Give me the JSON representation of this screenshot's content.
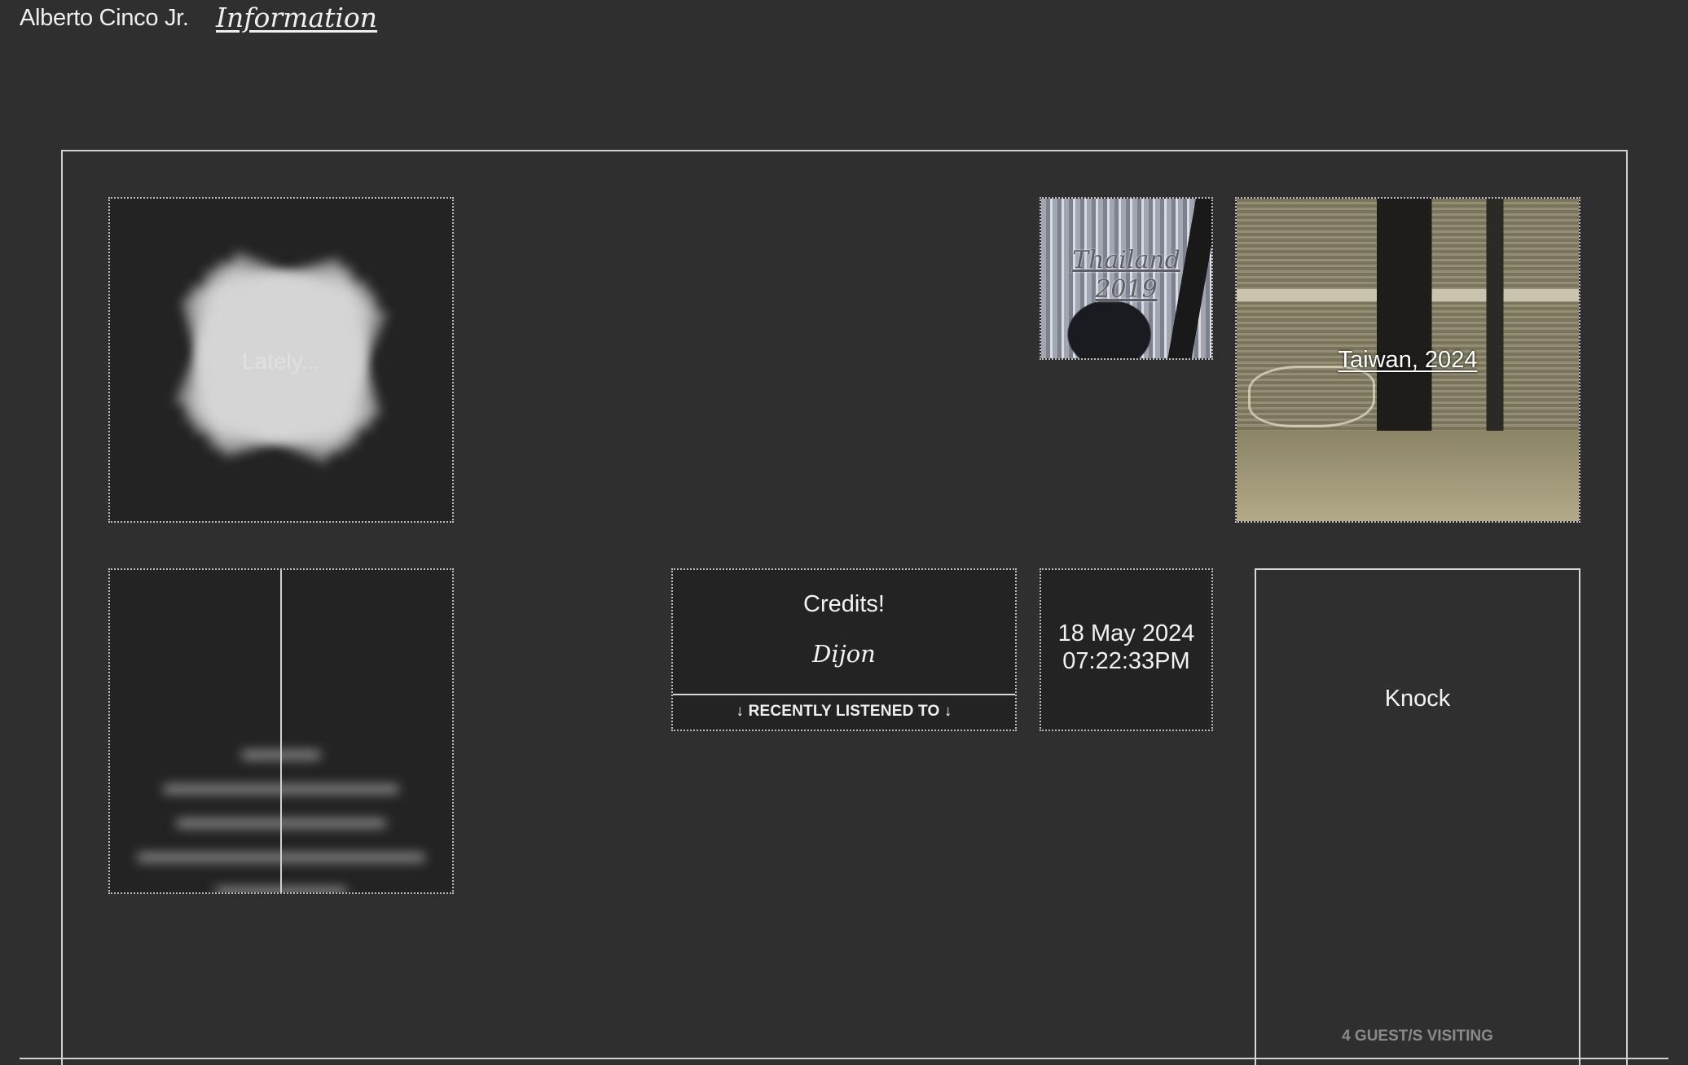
{
  "header": {
    "site_name": "Alberto Cinco Jr.",
    "info_link": "Information"
  },
  "tiles": {
    "lately": {
      "label": "Lately..."
    },
    "thailand": {
      "caption_line1": "Thailand",
      "caption_line2": "2019"
    },
    "taiwan": {
      "caption": "Taiwan, 2024"
    },
    "credits": {
      "title": "Credits!",
      "artist": "Dijon",
      "footer": "↓ RECENTLY LISTENED TO ↓"
    },
    "clock": {
      "date": "18 May 2024",
      "time": "07:22:33PM"
    },
    "knock": {
      "title": "Knock",
      "guests": "4 GUEST/S VISITING"
    }
  }
}
